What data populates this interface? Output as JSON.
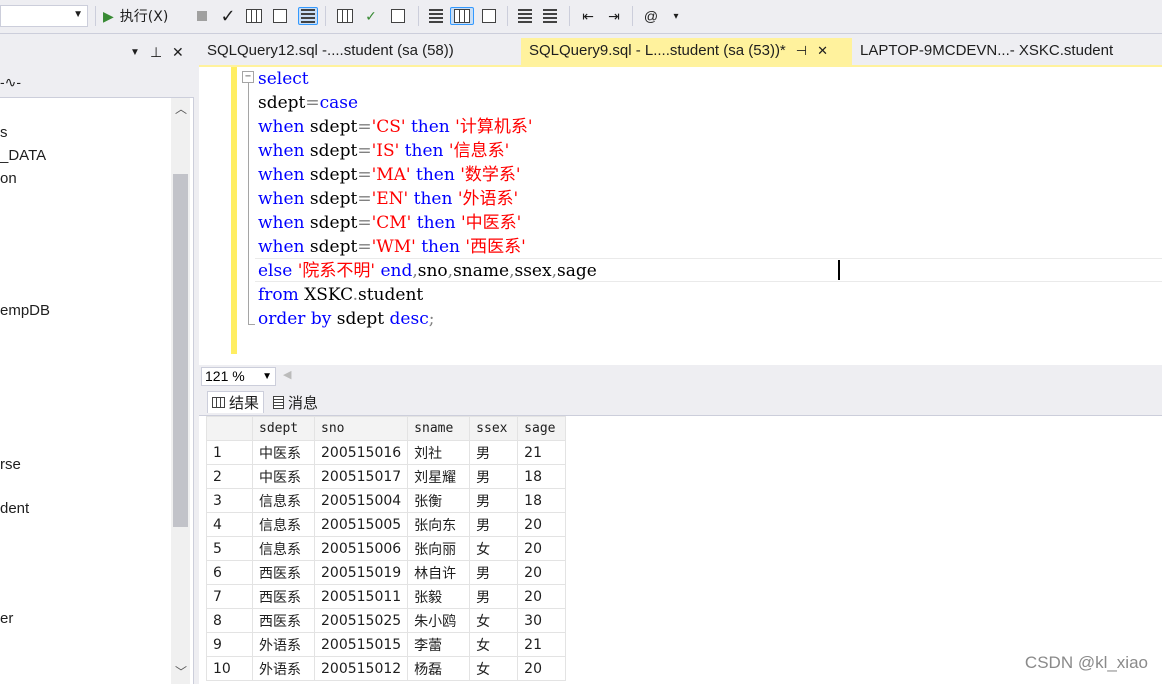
{
  "toolbar": {
    "execute_label": "执行(X)"
  },
  "tabs": [
    {
      "label": "SQLQuery12.sql -....student (sa (58))"
    },
    {
      "label": "SQLQuery9.sql - L....student (sa (53))*"
    },
    {
      "label": "LAPTOP-9MCDEVN...- XSKC.student"
    }
  ],
  "tree_items": [
    "s",
    "_DATA",
    "on",
    "empDB",
    "rse",
    "dent",
    "er"
  ],
  "editor": {
    "lines": [
      [
        {
          "t": "select",
          "c": "kw"
        }
      ],
      [
        {
          "t": "sdept",
          "c": "id"
        },
        {
          "t": "=",
          "c": "gr"
        },
        {
          "t": "case",
          "c": "kw"
        }
      ],
      [
        {
          "t": "when ",
          "c": "kw"
        },
        {
          "t": "sdept",
          "c": "id"
        },
        {
          "t": "=",
          "c": "gr"
        },
        {
          "t": "'CS'",
          "c": "str"
        },
        {
          "t": " then ",
          "c": "kw"
        },
        {
          "t": "'计算机系'",
          "c": "str"
        }
      ],
      [
        {
          "t": "when ",
          "c": "kw"
        },
        {
          "t": "sdept",
          "c": "id"
        },
        {
          "t": "=",
          "c": "gr"
        },
        {
          "t": "'IS'",
          "c": "str"
        },
        {
          "t": " then ",
          "c": "kw"
        },
        {
          "t": "'信息系'",
          "c": "str"
        }
      ],
      [
        {
          "t": "when ",
          "c": "kw"
        },
        {
          "t": "sdept",
          "c": "id"
        },
        {
          "t": "=",
          "c": "gr"
        },
        {
          "t": "'MA'",
          "c": "str"
        },
        {
          "t": " then ",
          "c": "kw"
        },
        {
          "t": "'数学系'",
          "c": "str"
        }
      ],
      [
        {
          "t": "when ",
          "c": "kw"
        },
        {
          "t": "sdept",
          "c": "id"
        },
        {
          "t": "=",
          "c": "gr"
        },
        {
          "t": "'EN'",
          "c": "str"
        },
        {
          "t": " then ",
          "c": "kw"
        },
        {
          "t": "'外语系'",
          "c": "str"
        }
      ],
      [
        {
          "t": "when ",
          "c": "kw"
        },
        {
          "t": "sdept",
          "c": "id"
        },
        {
          "t": "=",
          "c": "gr"
        },
        {
          "t": "'CM'",
          "c": "str"
        },
        {
          "t": " then ",
          "c": "kw"
        },
        {
          "t": "'中医系'",
          "c": "str"
        }
      ],
      [
        {
          "t": "when ",
          "c": "kw"
        },
        {
          "t": "sdept",
          "c": "id"
        },
        {
          "t": "=",
          "c": "gr"
        },
        {
          "t": "'WM'",
          "c": "str"
        },
        {
          "t": " then ",
          "c": "kw"
        },
        {
          "t": "'西医系'",
          "c": "str"
        }
      ],
      [
        {
          "t": "else ",
          "c": "kw"
        },
        {
          "t": "'院系不明'",
          "c": "str"
        },
        {
          "t": " end",
          "c": "kw"
        },
        {
          "t": ",",
          "c": "gr"
        },
        {
          "t": "sno",
          "c": "id"
        },
        {
          "t": ",",
          "c": "gr"
        },
        {
          "t": "sname",
          "c": "id"
        },
        {
          "t": ",",
          "c": "gr"
        },
        {
          "t": "ssex",
          "c": "id"
        },
        {
          "t": ",",
          "c": "gr"
        },
        {
          "t": "sage",
          "c": "id"
        }
      ],
      [
        {
          "t": "from ",
          "c": "kw"
        },
        {
          "t": "XSKC",
          "c": "id"
        },
        {
          "t": ".",
          "c": "gr"
        },
        {
          "t": "student",
          "c": "id"
        }
      ],
      [
        {
          "t": "order by ",
          "c": "kw"
        },
        {
          "t": "sdept ",
          "c": "id"
        },
        {
          "t": "desc",
          "c": "kw"
        },
        {
          "t": ";",
          "c": "gr"
        }
      ]
    ]
  },
  "zoom": "121 %",
  "results_tabs": {
    "results": "结果",
    "messages": "消息"
  },
  "grid": {
    "columns": [
      "sdept",
      "sno",
      "sname",
      "ssex",
      "sage"
    ],
    "rows": [
      [
        "1",
        "中医系",
        "200515016",
        "刘社",
        "男",
        "21"
      ],
      [
        "2",
        "中医系",
        "200515017",
        "刘星耀",
        "男",
        "18"
      ],
      [
        "3",
        "信息系",
        "200515004",
        "张衡",
        "男",
        "18"
      ],
      [
        "4",
        "信息系",
        "200515005",
        "张向东",
        "男",
        "20"
      ],
      [
        "5",
        "信息系",
        "200515006",
        "张向丽",
        "女",
        "20"
      ],
      [
        "6",
        "西医系",
        "200515019",
        "林自许",
        "男",
        "20"
      ],
      [
        "7",
        "西医系",
        "200515011",
        "张毅",
        "男",
        "20"
      ],
      [
        "8",
        "西医系",
        "200515025",
        "朱小鸥",
        "女",
        "30"
      ],
      [
        "9",
        "外语系",
        "200515015",
        "李蕾",
        "女",
        "21"
      ],
      [
        "10",
        "外语系",
        "200515012",
        "杨磊",
        "女",
        "20"
      ]
    ]
  },
  "watermark": "CSDN @kl_xiao",
  "colors": {
    "keyword": "#0000FF",
    "string": "#FF0000",
    "active_tab": "#FFF29D",
    "gutter": "#FFEE62"
  }
}
